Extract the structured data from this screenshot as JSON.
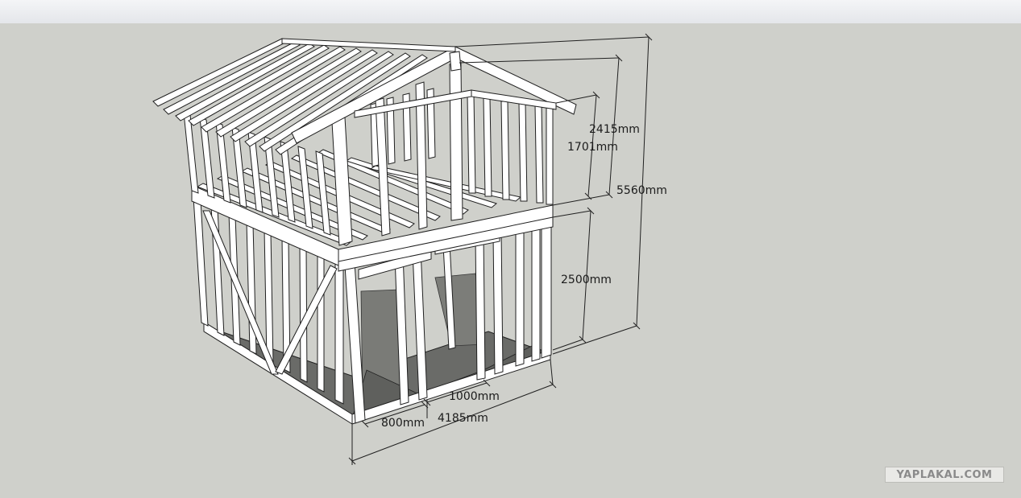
{
  "dimensions": {
    "roof_height": "2415mm",
    "attic_wall_height": "1701mm",
    "total_height": "5560mm",
    "ground_floor_height": "2500mm",
    "door_opening_wide": "1000mm",
    "door_opening_narrow": "800mm",
    "house_width": "4185mm"
  },
  "watermark": "YAPLAKAL.COM",
  "colors": {
    "background": "#cfd0cb",
    "timber": "#ffffff",
    "edge": "#202020",
    "floor": "#5e5f5c",
    "dimension_line": "#202020"
  }
}
